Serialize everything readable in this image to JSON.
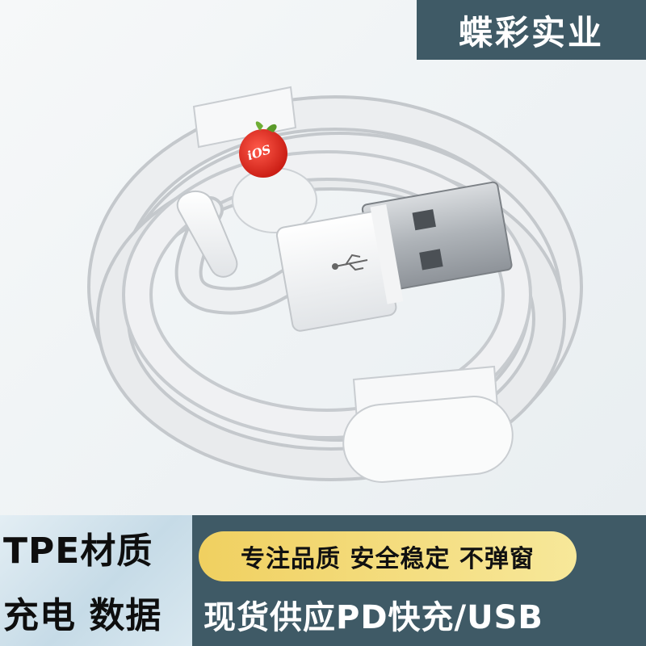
{
  "brand": "蝶彩实业",
  "badges": {
    "material": "TPE材质",
    "function": "充电 数据",
    "quality": "专注品质 安全稳定 不弹窗",
    "supply": "现货供应PD快充/USB"
  },
  "logo_text": "iOS",
  "colors": {
    "banner": "#3f5a66",
    "pill": "#f3dc7a",
    "cable": "#e9ebed",
    "apple": "#e2231a"
  }
}
